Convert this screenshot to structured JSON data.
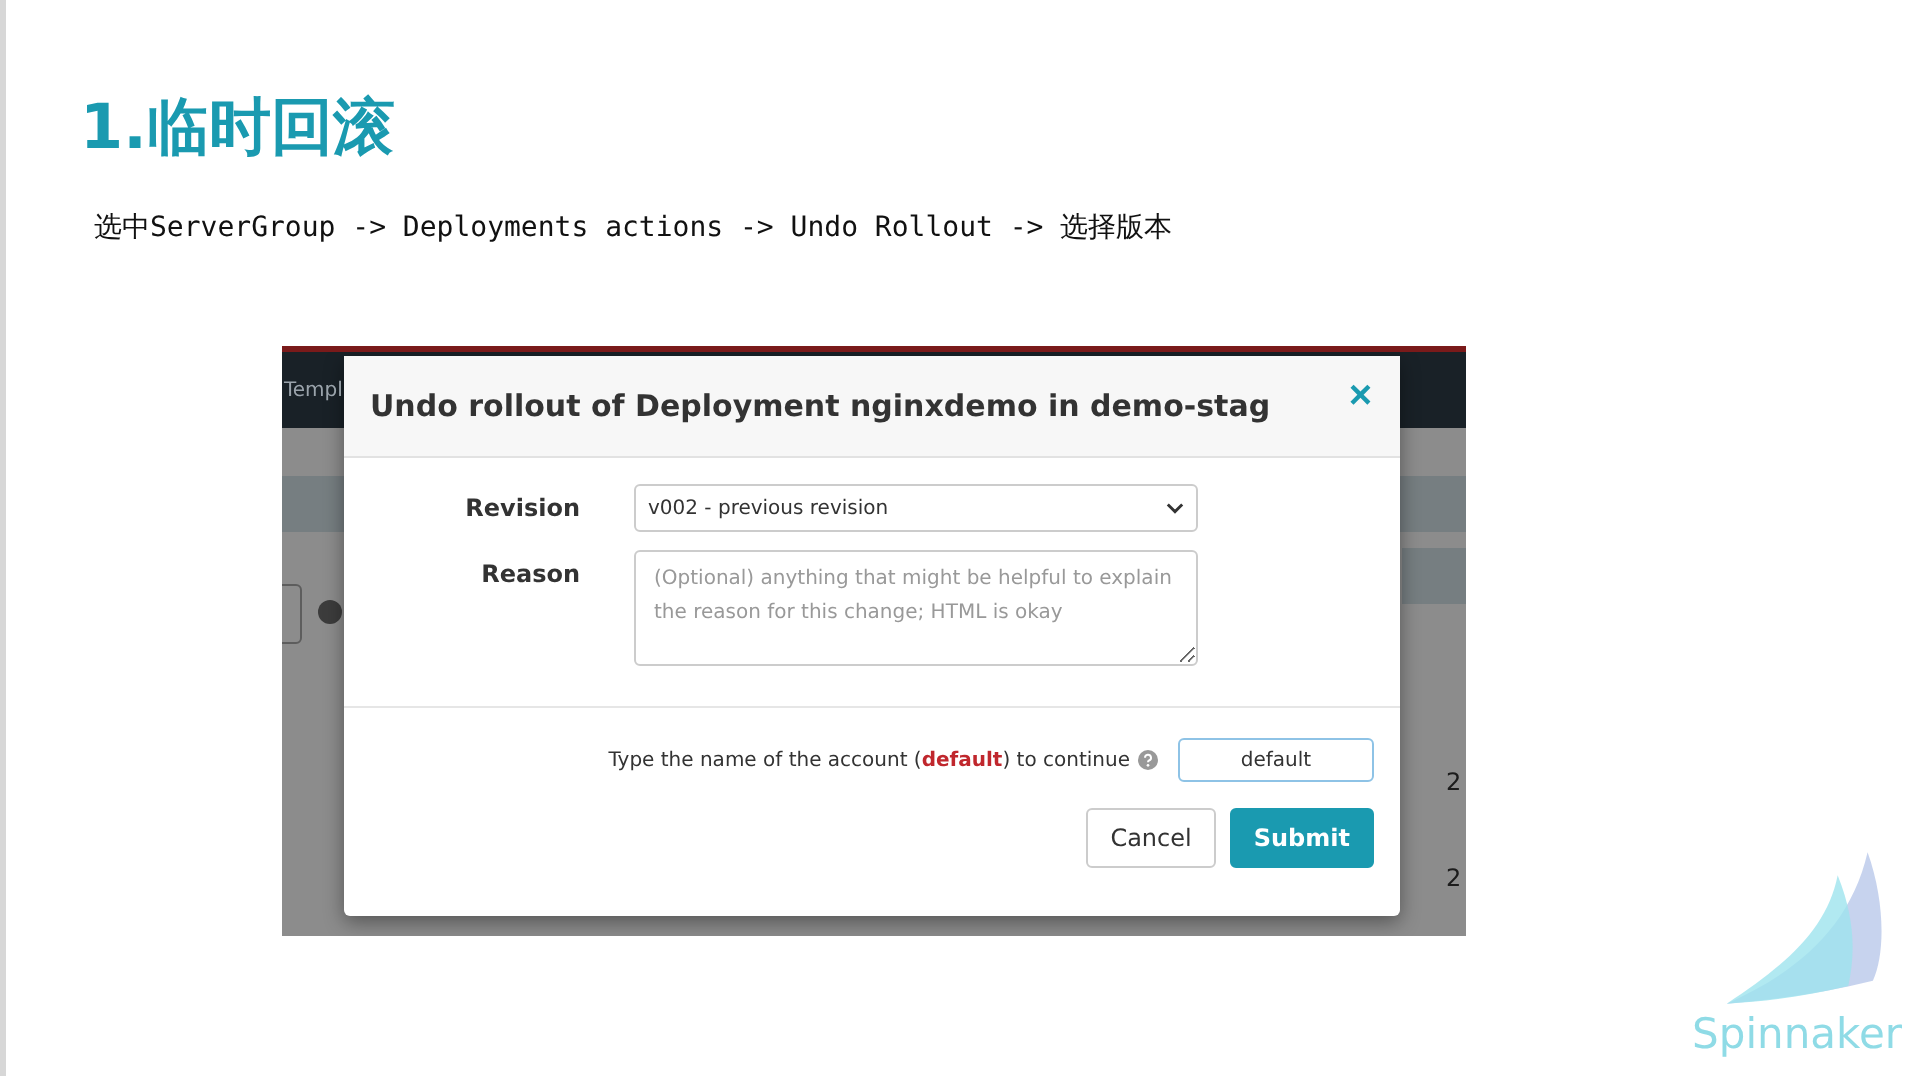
{
  "slide": {
    "title": "1.临时回滚",
    "subtitle": "选中ServerGroup -> Deployments actions -> Undo Rollout -> 选择版本"
  },
  "screenshot": {
    "background_app": {
      "header_text": "Templ",
      "cell_texts": [
        "2",
        "2"
      ]
    },
    "dialog": {
      "title": "Undo rollout of Deployment nginxdemo in demo-stag",
      "close": "×",
      "fields": [
        {
          "kind": "select",
          "label": "Revision",
          "value": "v002 - previous revision"
        },
        {
          "kind": "textarea",
          "label": "Reason",
          "placeholder": "(Optional) anything that might be helpful to explain the reason for this change; HTML is okay"
        }
      ],
      "confirm": {
        "prompt": "Type the name of the account (**default**) to continue",
        "value": "default"
      },
      "buttons": [
        {
          "kind": "secondary",
          "label": "Cancel"
        },
        {
          "kind": "primary",
          "label": "Submit"
        }
      ]
    }
  },
  "logo": {
    "text": "Spinnaker"
  }
}
